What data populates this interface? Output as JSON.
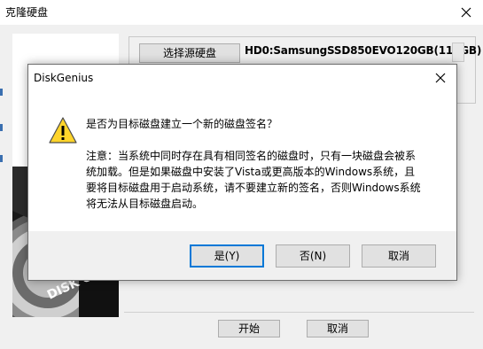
{
  "main_window": {
    "title": "克隆硬盘",
    "source_disk_button": "选择源硬盘",
    "source_disk_value": "HD0:SamsungSSD850EVO120GB(112GB) - ",
    "disk_image_text": "DISK G",
    "start_button": "开始",
    "cancel_button": "取消"
  },
  "dialog": {
    "title": "DiskGenius",
    "question": "是否为目标磁盘建立一个新的磁盘签名？",
    "note_lines": [
      "注意：当系统中同时存在具有相同签名的磁盘时，只有一块磁盘会被系",
      "统加载。但是如果磁盘中安装了Vista或更高版本的Windows系统，且",
      "要将目标磁盘用于启动系统，请不要建立新的签名，否则Windows系统",
      "将无法从目标磁盘启动。"
    ],
    "yes_button": "是(Y)",
    "no_button": "否(N)",
    "cancel_button": "取消",
    "icon": "warning-icon"
  },
  "colors": {
    "accent": "#0078d7",
    "warning_fill": "#ffd42a",
    "dialog_body_bg": "#ffffff",
    "window_bg": "#f0f0f0"
  }
}
